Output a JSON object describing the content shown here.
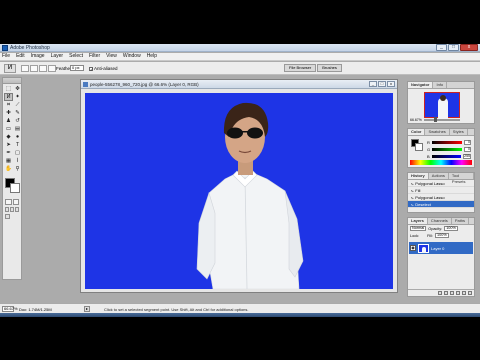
{
  "window": {
    "title": "Adobe Photoshop",
    "minimize": "_",
    "maximize": "□",
    "close": "x"
  },
  "menu": [
    "File",
    "Edit",
    "Image",
    "Layer",
    "Select",
    "Filter",
    "View",
    "Window",
    "Help"
  ],
  "options": {
    "feather_label": "Feather:",
    "feather_value": "0 px",
    "antialias_label": "Anti-aliased",
    "antialias_checked": true,
    "well_tabs": [
      "File Browser",
      "Brushes"
    ]
  },
  "toolbox": {
    "active_tool": "polygonal-lasso-tool",
    "foreground": "#000000",
    "background": "#ffffff"
  },
  "document": {
    "title": "people-556278_960_720.jpg @ 66.6% (Layer 0, RGB)",
    "canvas_color": "#1e34e6"
  },
  "navigator": {
    "tabs": [
      "Navigator",
      "Info"
    ],
    "zoom": "66.67%"
  },
  "color_panel": {
    "tabs": [
      "Color",
      "Swatches",
      "Styles"
    ],
    "channels": [
      {
        "label": "R",
        "value": "0"
      },
      {
        "label": "G",
        "value": "0"
      },
      {
        "label": "B",
        "value": "255"
      }
    ]
  },
  "history": {
    "tabs": [
      "History",
      "Actions",
      "Tool Presets"
    ],
    "items": [
      "Polygonal Lasso",
      "Fill",
      "Polygonal Lasso",
      "Deselect"
    ],
    "active_index": 3
  },
  "layers": {
    "tabs": [
      "Layers",
      "Channels",
      "Paths"
    ],
    "blend_mode": "Normal",
    "opacity_label": "Opacity:",
    "opacity": "100%",
    "lock_label": "Lock:",
    "fill_label": "Fill:",
    "fill": "100%",
    "layer_name": "Layer 0"
  },
  "status": {
    "zoom": "66.67%",
    "doc_info": "Doc: 1.74M/1.25M",
    "hint": "Click to set a selected segment point. Use Shift, Alt and Ctrl for additional options."
  }
}
